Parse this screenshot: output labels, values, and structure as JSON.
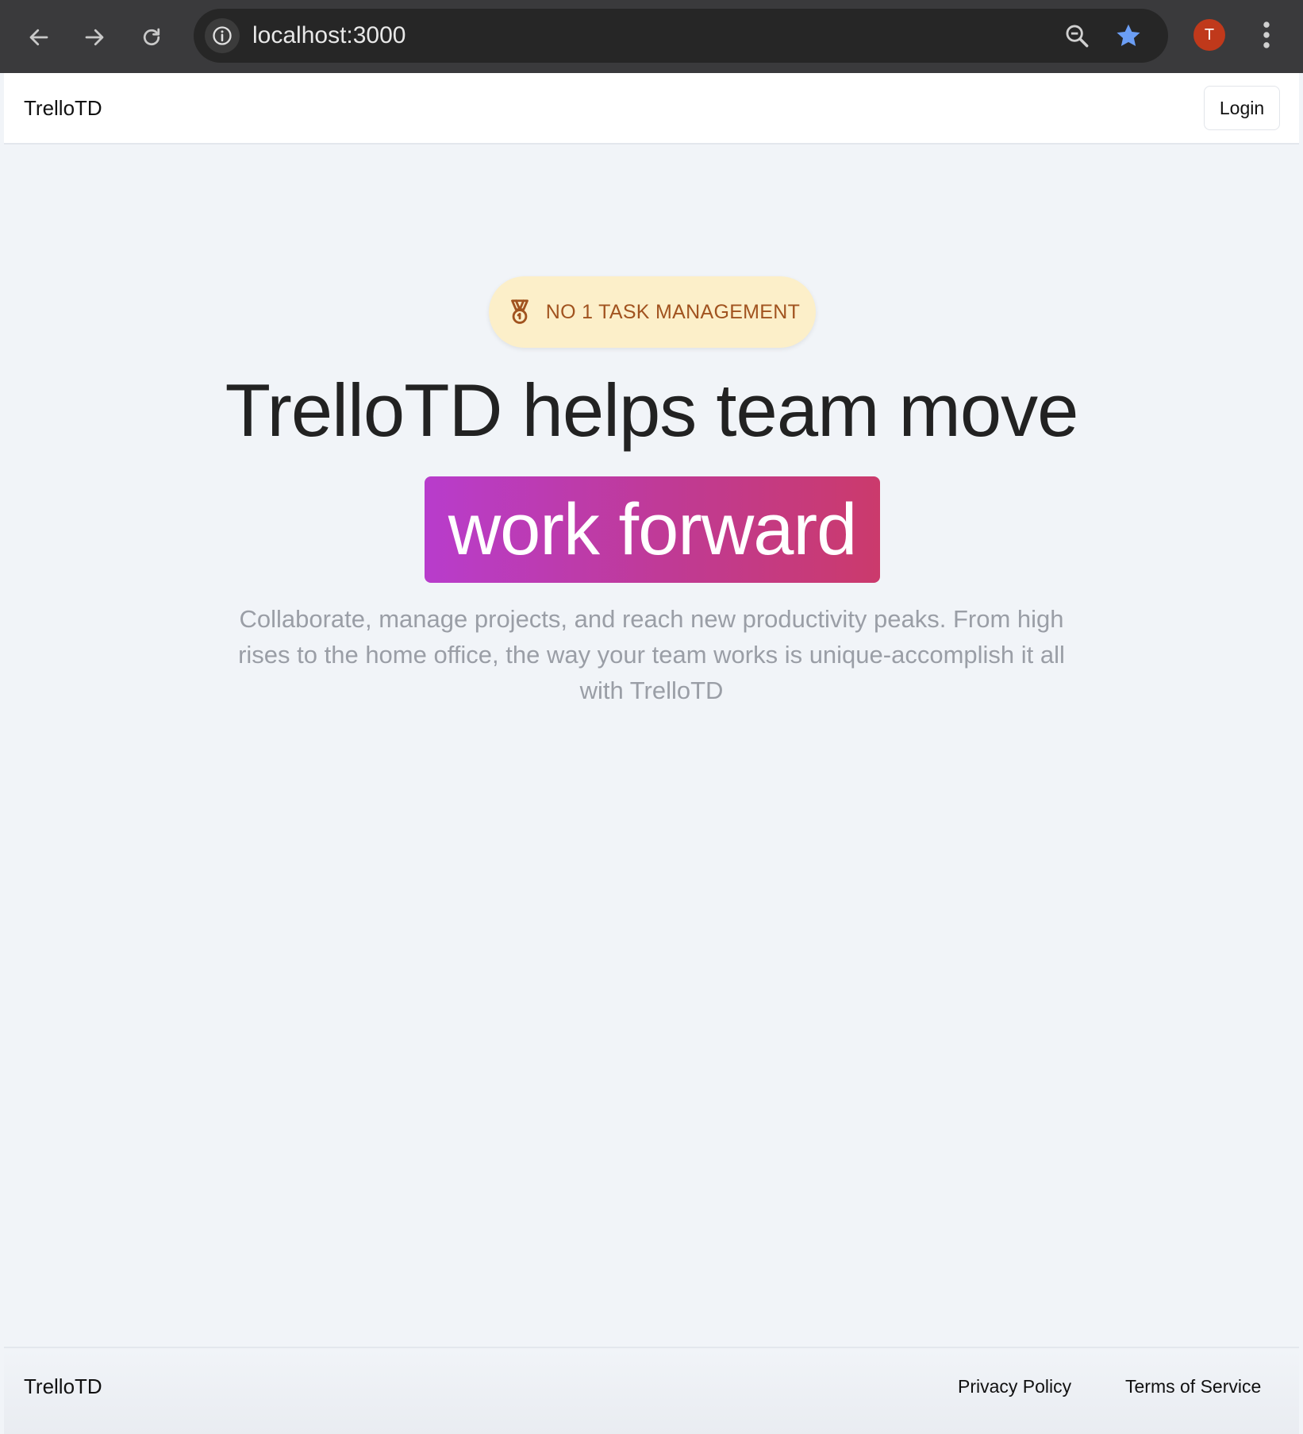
{
  "browser": {
    "url": "localhost:3000",
    "profile_initial": "T",
    "icons": [
      "back-arrow-icon",
      "forward-arrow-icon",
      "reload-icon",
      "info-icon",
      "zoom-icon",
      "star-icon",
      "more-vert-icon"
    ]
  },
  "header": {
    "brand": "TrelloTD",
    "login_label": "Login"
  },
  "hero": {
    "badge_text": "NO 1 TASK MANAGEMENT",
    "headline": "TrelloTD helps team move",
    "highlight": "work forward",
    "subtext": "Collaborate, manage projects, and reach new productivity peaks. From high rises to the home office, the way your team works is unique-accomplish it all with TrelloTD"
  },
  "footer": {
    "brand": "TrelloTD",
    "privacy": "Privacy Policy",
    "terms": "Terms of Service"
  },
  "colors": {
    "badge_bg": "#fcefc9",
    "badge_text": "#a1531f",
    "highlight_gradient_start": "#b83ccc",
    "highlight_gradient_end": "#cb3a6c",
    "star": "#6b9ef5",
    "avatar": "#c0391b"
  }
}
